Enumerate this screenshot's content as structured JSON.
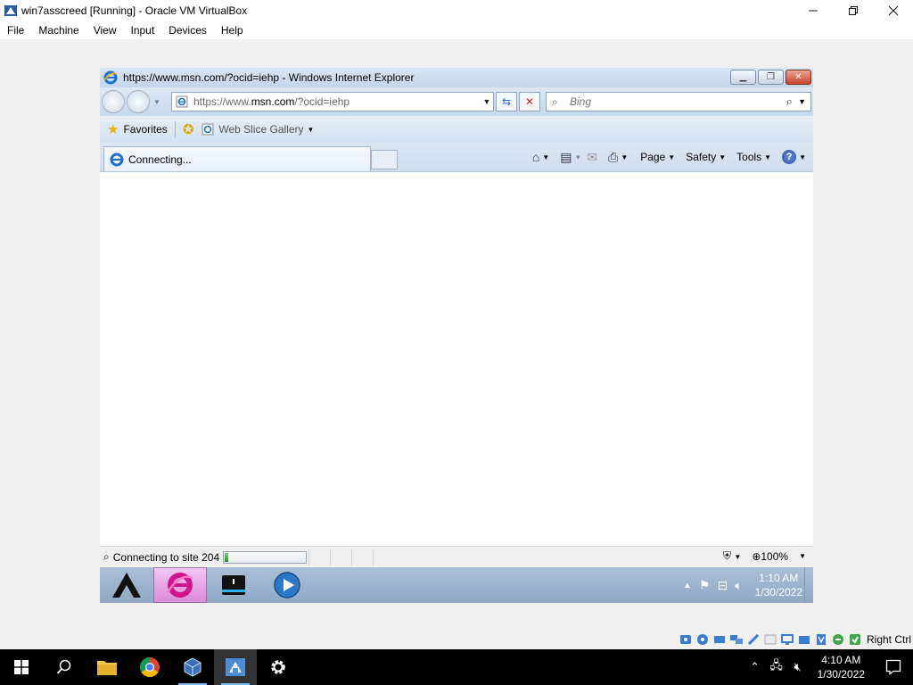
{
  "host": {
    "title": "win7asscreed [Running] - Oracle VM VirtualBox",
    "menu": [
      "File",
      "Machine",
      "View",
      "Input",
      "Devices",
      "Help"
    ],
    "host_key": "Right Ctrl",
    "clock": {
      "time": "4:10 AM",
      "date": "1/30/2022"
    }
  },
  "ie": {
    "title": "https://www.msn.com/?ocid=iehp - Windows Internet Explorer",
    "address": {
      "prefix": "https://www.",
      "domain": "msn.com",
      "suffix": "/?ocid=iehp"
    },
    "search_placeholder": "Bing",
    "favorites_label": "Favorites",
    "web_slice_label": "Web Slice Gallery",
    "tab_label": "Connecting...",
    "commands": {
      "page": "Page",
      "safety": "Safety",
      "tools": "Tools"
    },
    "status_text": "Connecting to site 204",
    "progress": 0.04,
    "zoom": "100%"
  },
  "guest_taskbar": {
    "clock": {
      "time": "1:10 AM",
      "date": "1/30/2022"
    }
  },
  "colors": {
    "ie_chrome": "#c7d9ee",
    "guest_taskbar": "#9bb2cd",
    "progress_green": "#1e9a1e",
    "host_taskbar": "#000000"
  }
}
